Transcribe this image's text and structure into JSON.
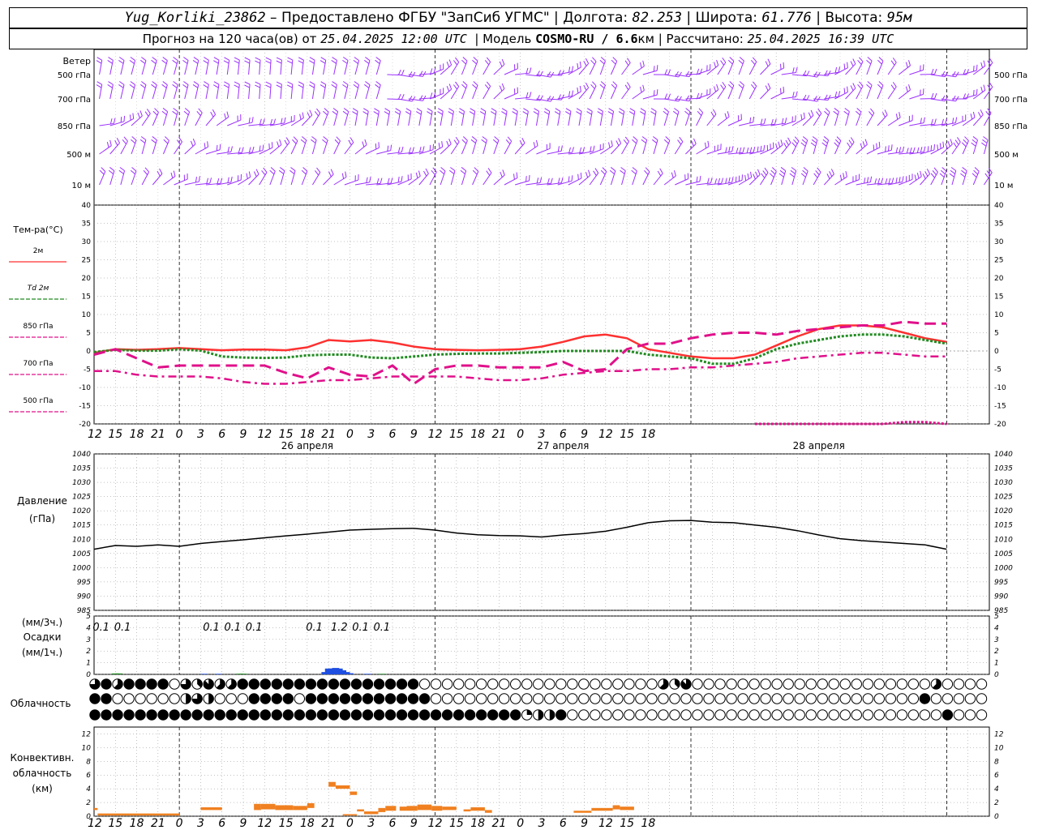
{
  "header": {
    "station": "Yug_Korliki_23862",
    "provider": "– Предоставлено ФГБУ \"ЗапСиб УГМС\"",
    "lon_label": "Долгота:",
    "lon": "82.253",
    "lat_label": "Широта:",
    "lat": "61.776",
    "alt_label": "Высота:",
    "alt": "95м",
    "forecast_label": "Прогноз на 120 часа(ов) от",
    "forecast_start": "25.04.2025 12:00 UTC",
    "model_label": "Модель",
    "model": "COSMO-RU / 6.6",
    "model_unit": "км",
    "calc_label": "Рассчитано:",
    "calc_time": "25.04.2025 16:39 UTC"
  },
  "chart_data": [
    {
      "type": "wind_barbs",
      "title": "Ветер",
      "levels": [
        "500 гПа",
        "700 гПа",
        "850 гПа",
        "500 м",
        "10 м"
      ],
      "color": "#9b30ff"
    },
    {
      "type": "line",
      "ylabel": "Тем-ра(°C)",
      "ylim": [
        -20,
        40
      ],
      "yticks": [
        -20,
        -15,
        -10,
        -5,
        0,
        5,
        10,
        15,
        20,
        25,
        30,
        35,
        40
      ],
      "x_hours": [
        0,
        3,
        6,
        9,
        12,
        15,
        18,
        21,
        24,
        27,
        30,
        33,
        36,
        39,
        42,
        45,
        48,
        51,
        54,
        57,
        60,
        63,
        66,
        69,
        72,
        75,
        78,
        81,
        84,
        87,
        90,
        93,
        96,
        99,
        102,
        105,
        108,
        111,
        114,
        117,
        120,
        123,
        126
      ],
      "series": [
        {
          "name": "2м",
          "color": "#ff3030",
          "style": "solid",
          "values": [
            -0.5,
            0.5,
            0.3,
            0.5,
            0.8,
            0.5,
            0.2,
            0.4,
            0.4,
            0.2,
            1.0,
            3.0,
            2.6,
            3.0,
            2.3,
            1.2,
            0.5,
            0.3,
            0.2,
            0.3,
            0.5,
            1.2,
            2.5,
            4.0,
            4.5,
            3.5,
            0.5,
            -0.5,
            -1.5,
            -2.0,
            -2.0,
            -1.0,
            1.5,
            4.0,
            6.0,
            7.0,
            7.0,
            6.5,
            5.0,
            3.5,
            2.5
          ]
        },
        {
          "name": "Td 2м",
          "color": "#228b22",
          "style": "dotted",
          "values": [
            -0.3,
            0.3,
            0.1,
            0.1,
            0.5,
            0.1,
            -1.5,
            -1.8,
            -1.9,
            -1.8,
            -1.2,
            -1.0,
            -1.0,
            -1.8,
            -2.0,
            -1.5,
            -1.0,
            -0.8,
            -0.7,
            -0.7,
            -0.5,
            -0.3,
            0.0,
            0.0,
            0.0,
            0.0,
            -1.0,
            -1.5,
            -2.0,
            -3.5,
            -3.5,
            -2.0,
            0.5,
            2.0,
            3.0,
            4.0,
            4.5,
            4.5,
            4.0,
            3.0,
            2.0
          ]
        },
        {
          "name": "850 гПа",
          "color": "#e0108a",
          "style": "dashed",
          "values": [
            -1.0,
            0.5,
            -2.0,
            -4.5,
            -4.0,
            -4.0,
            -4.0,
            -4.0,
            -4.0,
            -6.0,
            -7.5,
            -4.5,
            -6.5,
            -7.0,
            -4.0,
            -9.0,
            -5.0,
            -4.0,
            -4.0,
            -4.5,
            -4.5,
            -4.5,
            -3.0,
            -5.5,
            -5.0,
            0.5,
            2.0,
            2.0,
            3.5,
            4.5,
            5.0,
            5.0,
            4.5,
            5.5,
            6.0,
            6.5,
            7.0,
            7.0,
            8.0,
            7.5,
            7.5
          ]
        },
        {
          "name": "700 гПа",
          "color": "#e0108a",
          "style": "dashdot",
          "values": [
            -5.5,
            -5.5,
            -6.5,
            -7.0,
            -7.0,
            -7.0,
            -7.5,
            -8.5,
            -9.0,
            -9.0,
            -8.5,
            -8.0,
            -8.0,
            -7.5,
            -7.0,
            -7.0,
            -7.0,
            -7.0,
            -7.5,
            -8.0,
            -8.0,
            -7.5,
            -6.5,
            -6.0,
            -5.5,
            -5.5,
            -5.0,
            -5.0,
            -4.5,
            -4.5,
            -4.0,
            -3.5,
            -3.0,
            -2.0,
            -1.5,
            -1.0,
            -0.5,
            -0.5,
            -1.0,
            -1.5,
            -1.5
          ]
        },
        {
          "name": "500 гПа",
          "color": "#e0108a",
          "style": "dotted",
          "values": [
            null,
            null,
            null,
            null,
            null,
            null,
            null,
            null,
            null,
            null,
            null,
            null,
            null,
            null,
            null,
            null,
            null,
            null,
            null,
            null,
            null,
            null,
            null,
            null,
            null,
            null,
            null,
            null,
            null,
            null,
            null,
            -20,
            -20,
            -20,
            -20,
            -20,
            -20,
            -20,
            -19.5,
            -19.5,
            -20
          ]
        }
      ],
      "xticks": [
        "12",
        "15",
        "18",
        "21",
        "0",
        "3",
        "6",
        "9",
        "12",
        "15",
        "18",
        "21",
        "0",
        "3",
        "6",
        "9",
        "12",
        "15",
        "18",
        "21",
        "0",
        "3",
        "6",
        "9",
        "12",
        "15",
        "18"
      ],
      "day_labels": [
        "26 апреля",
        "27 апреля",
        "28 апреля"
      ]
    },
    {
      "type": "line",
      "ylabel": "Давление",
      "ylabel2": "(гПа)",
      "ylim": [
        985,
        1040
      ],
      "yticks": [
        985,
        990,
        995,
        1000,
        1005,
        1010,
        1015,
        1020,
        1025,
        1030,
        1035,
        1040
      ],
      "series": [
        {
          "name": "Давление",
          "color": "#000000",
          "values": [
            1006.5,
            1007.8,
            1007.5,
            1008.0,
            1007.5,
            1008.5,
            1009.2,
            1009.8,
            1010.5,
            1011.2,
            1011.8,
            1012.5,
            1013.2,
            1013.5,
            1013.7,
            1013.8,
            1013.2,
            1012.2,
            1011.6,
            1011.3,
            1011.2,
            1010.8,
            1011.5,
            1012.0,
            1012.8,
            1014.2,
            1015.8,
            1016.5,
            1016.6,
            1016.0,
            1015.8,
            1015.0,
            1014.2,
            1013.0,
            1011.5,
            1010.2,
            1009.5,
            1009.0,
            1008.5,
            1008.0,
            1006.5
          ]
        }
      ]
    },
    {
      "type": "bar",
      "ylabel": "(мм/3ч.)",
      "ylabel2": "Осадки",
      "ylabel3": "(мм/1ч.)",
      "ylim": [
        0,
        5
      ],
      "yticks": [
        0,
        1,
        2,
        3,
        4,
        5
      ],
      "labels": [
        {
          "hour": 1,
          "text": "0.1"
        },
        {
          "hour": 4,
          "text": "0.1"
        },
        {
          "hour": 16.5,
          "text": "0.1"
        },
        {
          "hour": 19.5,
          "text": "0.1"
        },
        {
          "hour": 22.5,
          "text": "0.1"
        },
        {
          "hour": 31,
          "text": "0.1"
        },
        {
          "hour": 34.5,
          "text": "1.2"
        },
        {
          "hour": 37.5,
          "text": "0.1"
        },
        {
          "hour": 40.5,
          "text": "0.1"
        }
      ],
      "bars_mm_per_hour": [
        {
          "hour": 32.5,
          "value": 0.2,
          "color": "#1f4fe0"
        },
        {
          "hour": 33.0,
          "value": 0.5,
          "color": "#1f4fe0"
        },
        {
          "hour": 33.5,
          "value": 0.5,
          "color": "#1f4fe0"
        },
        {
          "hour": 34.0,
          "value": 0.55,
          "color": "#1f4fe0"
        },
        {
          "hour": 34.5,
          "value": 0.5,
          "color": "#1f4fe0"
        },
        {
          "hour": 35.0,
          "value": 0.35,
          "color": "#1f4fe0"
        },
        {
          "hour": 35.5,
          "value": 0.2,
          "color": "#1f4fe0"
        },
        {
          "hour": 36.0,
          "value": 0.1,
          "color": "#1f4fe0"
        },
        {
          "hour": 3.0,
          "value": 0.08,
          "color": "#228b22"
        },
        {
          "hour": 3.5,
          "value": 0.08,
          "color": "#228b22"
        },
        {
          "hour": 20.5,
          "value": 0.06,
          "color": "#228b22"
        },
        {
          "hour": 21.0,
          "value": 0.06,
          "color": "#228b22"
        },
        {
          "hour": 15.5,
          "value": 0.05,
          "color": "#1f4fe0"
        },
        {
          "hour": 17.5,
          "value": 0.05,
          "color": "#1f4fe0"
        },
        {
          "hour": 38.5,
          "value": 0.05,
          "color": "#1f4fe0"
        },
        {
          "hour": 40.5,
          "value": 0.05,
          "color": "#228b22"
        }
      ]
    },
    {
      "type": "table",
      "title": "Облачность",
      "rows_cover_eighths": [
        [
          6,
          8,
          4,
          5,
          6,
          8,
          8,
          8,
          8,
          8,
          8,
          4,
          0,
          3,
          6,
          0,
          3,
          7,
          5,
          5,
          4,
          5,
          4,
          8,
          4,
          8,
          8,
          8,
          8,
          8,
          8,
          8,
          8,
          8,
          8,
          8,
          8,
          8,
          8,
          8,
          8,
          8,
          8,
          8,
          8,
          8,
          8,
          8,
          8,
          8,
          8,
          0,
          0,
          0,
          0,
          0,
          0,
          0,
          0,
          0,
          0,
          0,
          0,
          0,
          0,
          0,
          0,
          0,
          0,
          0,
          0,
          0,
          0,
          0,
          0,
          0,
          0,
          0,
          0,
          0,
          0,
          0,
          0,
          0,
          0,
          1,
          0,
          0,
          0,
          5,
          0,
          3,
          0,
          7,
          0,
          0,
          0,
          0,
          0,
          0,
          0,
          0,
          0,
          0,
          0,
          0,
          0,
          0,
          0,
          0,
          0,
          0,
          0,
          0,
          0,
          0,
          0,
          0,
          0,
          0,
          0,
          0,
          0,
          0,
          0,
          0,
          0,
          0,
          0,
          0,
          0,
          0,
          0,
          5,
          0,
          0,
          0,
          0,
          0,
          0,
          0,
          0
        ],
        [
          8,
          8,
          6,
          0,
          0,
          0,
          0,
          0,
          0,
          0,
          0,
          0,
          0,
          0,
          4,
          6,
          4,
          4,
          0,
          0,
          6,
          0,
          0,
          0,
          8,
          8,
          8,
          8,
          8,
          8,
          4,
          0,
          8,
          8,
          8,
          8,
          8,
          8,
          8,
          8,
          8,
          8,
          8,
          8,
          8,
          8,
          8,
          8,
          8,
          8,
          8,
          8,
          0,
          0,
          0,
          0,
          0,
          0,
          0,
          0,
          0,
          0,
          0,
          0,
          0,
          0,
          0,
          0,
          0,
          0,
          0,
          0,
          0,
          0,
          0,
          0,
          0,
          0,
          0,
          0,
          0,
          0,
          0,
          0,
          0,
          0,
          0,
          0,
          0,
          0,
          0,
          0,
          0,
          0,
          0,
          0,
          0,
          0,
          0,
          0,
          0,
          0,
          0,
          0,
          0,
          0,
          0,
          0,
          0,
          0,
          0,
          0,
          0,
          0,
          0,
          0,
          0,
          0,
          0,
          0,
          0,
          0,
          0,
          0,
          0,
          0,
          0,
          0,
          8,
          0,
          0,
          0,
          0,
          0,
          0,
          0,
          0,
          0,
          0
        ],
        [
          8,
          8,
          8,
          8,
          8,
          8,
          8,
          8,
          8,
          8,
          8,
          8,
          8,
          8,
          8,
          8,
          8,
          8,
          8,
          8,
          8,
          8,
          8,
          8,
          8,
          8,
          8,
          8,
          8,
          8,
          8,
          8,
          8,
          8,
          8,
          8,
          8,
          8,
          8,
          8,
          8,
          8,
          8,
          8,
          2,
          8,
          8,
          8,
          8,
          8,
          8,
          2,
          8,
          8,
          8,
          8,
          8,
          8,
          8,
          8,
          8,
          8,
          8,
          8,
          6,
          8,
          8,
          4,
          2,
          2,
          4,
          2,
          4,
          6,
          8,
          2,
          0,
          0,
          2,
          0,
          0,
          0,
          0,
          0,
          0,
          0,
          0,
          0,
          0,
          0,
          0,
          0,
          0,
          0,
          0,
          0,
          0,
          0,
          0,
          0,
          0,
          0,
          0,
          0,
          0,
          0,
          0,
          0,
          0,
          0,
          0,
          0,
          0,
          0,
          0,
          0,
          0,
          0,
          0,
          0,
          0,
          0,
          0,
          0,
          0,
          0,
          0,
          0,
          0,
          0,
          0,
          0,
          0,
          0,
          0,
          8,
          8,
          0,
          0,
          0,
          0,
          0,
          0
        ]
      ]
    },
    {
      "type": "bar",
      "ylabel": "Конвективн.",
      "ylabel2": "облачность",
      "ylabel3": "(км)",
      "ylim": [
        0,
        13
      ],
      "yticks": [
        0,
        2,
        4,
        6,
        8,
        10,
        12
      ],
      "color": "#f08020",
      "segments": [
        {
          "from": 0,
          "to": 0.5,
          "top": 1.2,
          "bottom": 0.9
        },
        {
          "from": 0.5,
          "to": 12,
          "top": 0.4,
          "bottom": 0.1
        },
        {
          "from": 15,
          "to": 18,
          "top": 1.3,
          "bottom": 0.9
        },
        {
          "from": 22.5,
          "to": 23.5,
          "top": 1.8,
          "bottom": 0.9
        },
        {
          "from": 23.5,
          "to": 25.5,
          "top": 1.8,
          "bottom": 1.0
        },
        {
          "from": 25.5,
          "to": 28,
          "top": 1.6,
          "bottom": 0.9
        },
        {
          "from": 28,
          "to": 30,
          "top": 1.5,
          "bottom": 0.9
        },
        {
          "from": 30,
          "to": 31,
          "top": 1.9,
          "bottom": 1.2
        },
        {
          "from": 33,
          "to": 34,
          "top": 5.0,
          "bottom": 4.3
        },
        {
          "from": 34,
          "to": 36,
          "top": 4.5,
          "bottom": 4.0
        },
        {
          "from": 35,
          "to": 37,
          "top": 0.3,
          "bottom": 0.1
        },
        {
          "from": 36,
          "to": 37,
          "top": 3.6,
          "bottom": 3.1
        },
        {
          "from": 37,
          "to": 38,
          "top": 1.0,
          "bottom": 0.7
        },
        {
          "from": 38,
          "to": 40,
          "top": 0.7,
          "bottom": 0.3
        },
        {
          "from": 40,
          "to": 41,
          "top": 1.2,
          "bottom": 0.6
        },
        {
          "from": 41,
          "to": 42.5,
          "top": 1.5,
          "bottom": 0.8
        },
        {
          "from": 43,
          "to": 44,
          "top": 1.4,
          "bottom": 0.8
        },
        {
          "from": 44,
          "to": 45.5,
          "top": 1.5,
          "bottom": 0.8
        },
        {
          "from": 45.5,
          "to": 47.5,
          "top": 1.7,
          "bottom": 0.9
        },
        {
          "from": 47.5,
          "to": 49,
          "top": 1.5,
          "bottom": 0.8
        },
        {
          "from": 49,
          "to": 51,
          "top": 1.4,
          "bottom": 0.9
        },
        {
          "from": 52,
          "to": 53,
          "top": 1.0,
          "bottom": 0.7
        },
        {
          "from": 53,
          "to": 55,
          "top": 1.3,
          "bottom": 0.8
        },
        {
          "from": 55,
          "to": 56,
          "top": 0.9,
          "bottom": 0.5
        },
        {
          "from": 67.5,
          "to": 70,
          "top": 0.8,
          "bottom": 0.5
        },
        {
          "from": 70,
          "to": 73,
          "top": 1.2,
          "bottom": 0.8
        },
        {
          "from": 73,
          "to": 74,
          "top": 1.6,
          "bottom": 1.0
        },
        {
          "from": 74,
          "to": 76,
          "top": 1.4,
          "bottom": 0.9
        }
      ]
    }
  ]
}
